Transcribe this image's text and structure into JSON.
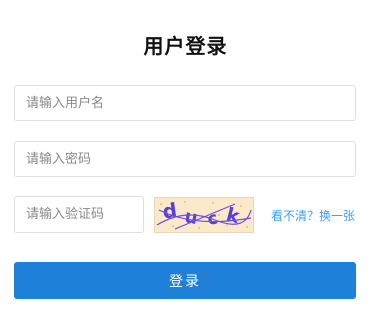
{
  "page": {
    "title": "用户登录"
  },
  "form": {
    "username_placeholder": "请输入用户名",
    "username_value": "",
    "password_placeholder": "请输入密码",
    "password_value": "",
    "captcha_placeholder": "请输入验证码",
    "captcha_value": "",
    "captcha_image_text": "duck",
    "refresh_link": "看不清？换一张",
    "submit_label": "登录"
  },
  "colors": {
    "primary": "#1e80d8",
    "link": "#409eff",
    "captcha_bg": "#fbe9c9",
    "captcha_text": "#5a3fd6"
  }
}
